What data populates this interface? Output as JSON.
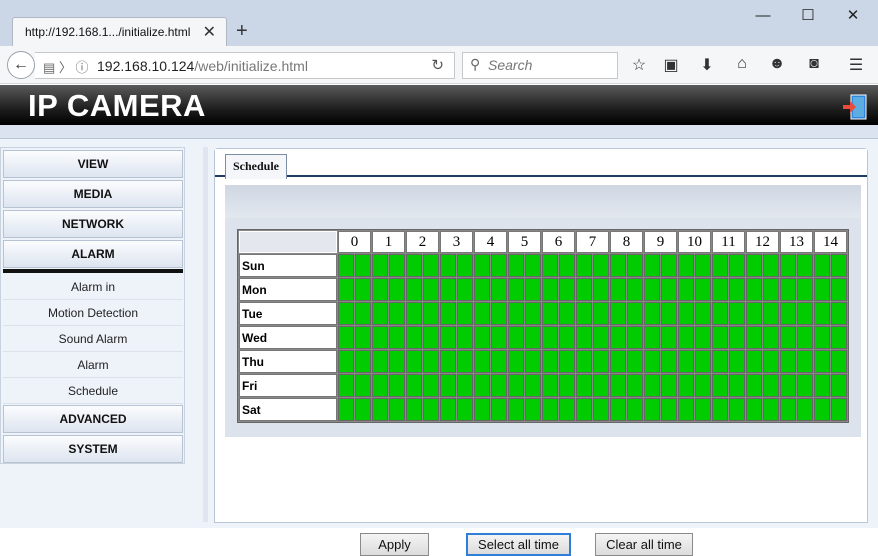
{
  "browser": {
    "tab_title": "http://192.168.1.../initialize.html",
    "tab_close": "✕",
    "new_tab": "+",
    "window_controls": {
      "minimize": "—",
      "maximize": "☐",
      "close": "✕"
    },
    "url_host": "192.168.10.124",
    "url_path": "/web/initialize.html",
    "search_placeholder": "Search",
    "toolbar_icons": [
      "star-icon",
      "reading-list-icon",
      "download-icon",
      "home-icon",
      "emoji-icon",
      "pocket-icon",
      "menu-icon"
    ]
  },
  "header": {
    "title": "IP CAMERA",
    "exit_icon": "exit-door-icon"
  },
  "sidebar": {
    "menu": {
      "view": "VIEW",
      "media": "MEDIA",
      "network": "NETWORK",
      "alarm": "ALARM",
      "advanced": "ADVANCED",
      "system": "SYSTEM"
    },
    "alarm_items": [
      "Alarm in",
      "Motion Detection",
      "Sound Alarm",
      "Alarm",
      "Schedule"
    ]
  },
  "main": {
    "tab_label": "Schedule",
    "hours": [
      "0",
      "1",
      "2",
      "3",
      "4",
      "5",
      "6",
      "7",
      "8",
      "9",
      "10",
      "11",
      "12",
      "13",
      "14"
    ],
    "days": [
      "Sun",
      "Mon",
      "Tue",
      "Wed",
      "Thu",
      "Fri",
      "Sat"
    ],
    "all_selected": true,
    "selected_color": "#00cc00",
    "buttons": {
      "apply": "Apply",
      "select_all": "Select all time",
      "clear_all": "Clear all time"
    }
  }
}
